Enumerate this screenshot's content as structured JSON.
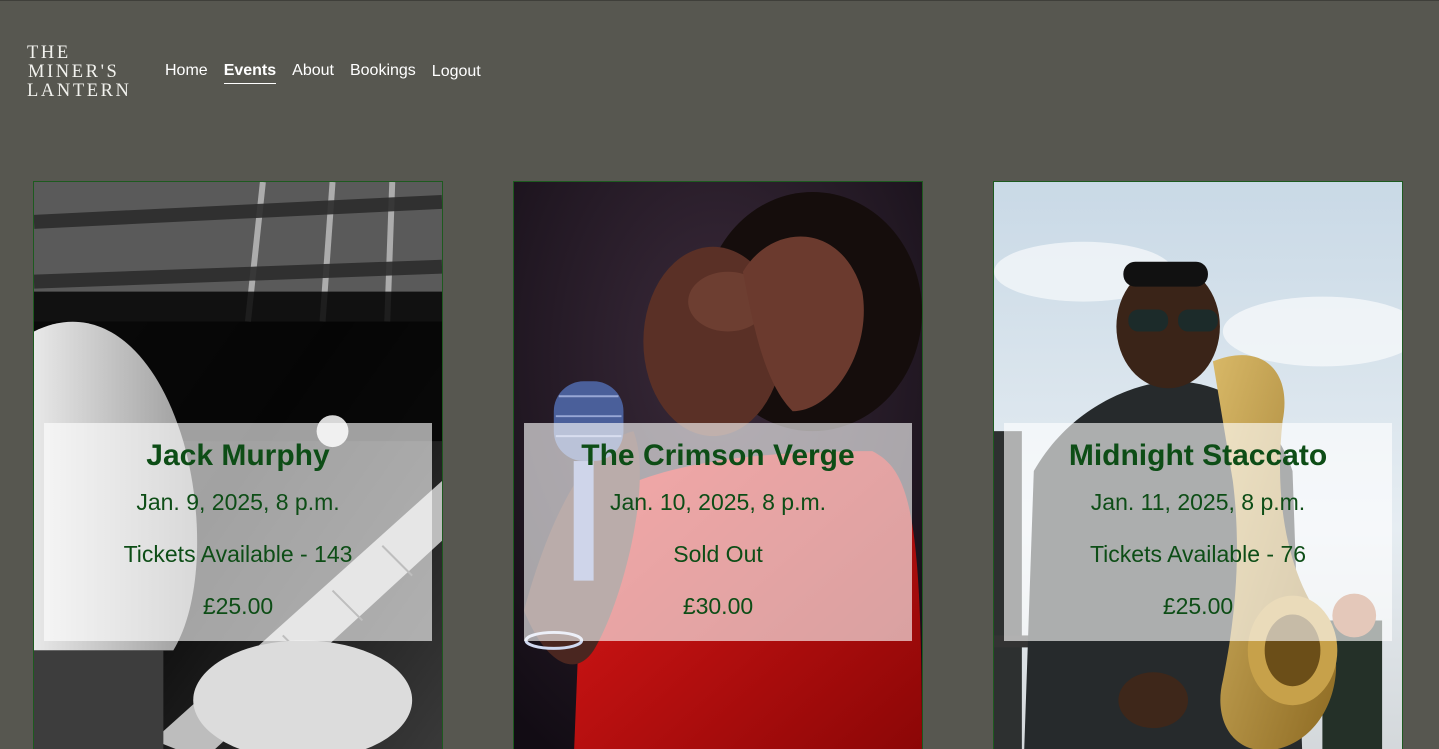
{
  "brand": {
    "line1": "THE",
    "line2": "MINER'S",
    "line3": "LANTERN"
  },
  "nav": {
    "home": "Home",
    "events": "Events",
    "about": "About",
    "bookings": "Bookings",
    "logout": "Logout",
    "active": "Events"
  },
  "events": [
    {
      "name": "Jack Murphy",
      "datetime": "Jan. 9, 2025, 8 p.m.",
      "availability": "Tickets Available - 143",
      "price": "£25.00",
      "photo": "guitarist-photo"
    },
    {
      "name": "The Crimson Verge",
      "datetime": "Jan. 10, 2025, 8 p.m.",
      "availability": "Sold Out",
      "price": "£30.00",
      "photo": "singer-photo"
    },
    {
      "name": "Midnight Staccato",
      "datetime": "Jan. 11, 2025, 8 p.m.",
      "availability": "Tickets Available - 76",
      "price": "£25.00",
      "photo": "saxophonist-photo"
    }
  ],
  "colors": {
    "page_background": "#575750",
    "card_border": "#1d5a1f",
    "card_text": "#0d4d16",
    "nav_text": "#ffffff"
  }
}
